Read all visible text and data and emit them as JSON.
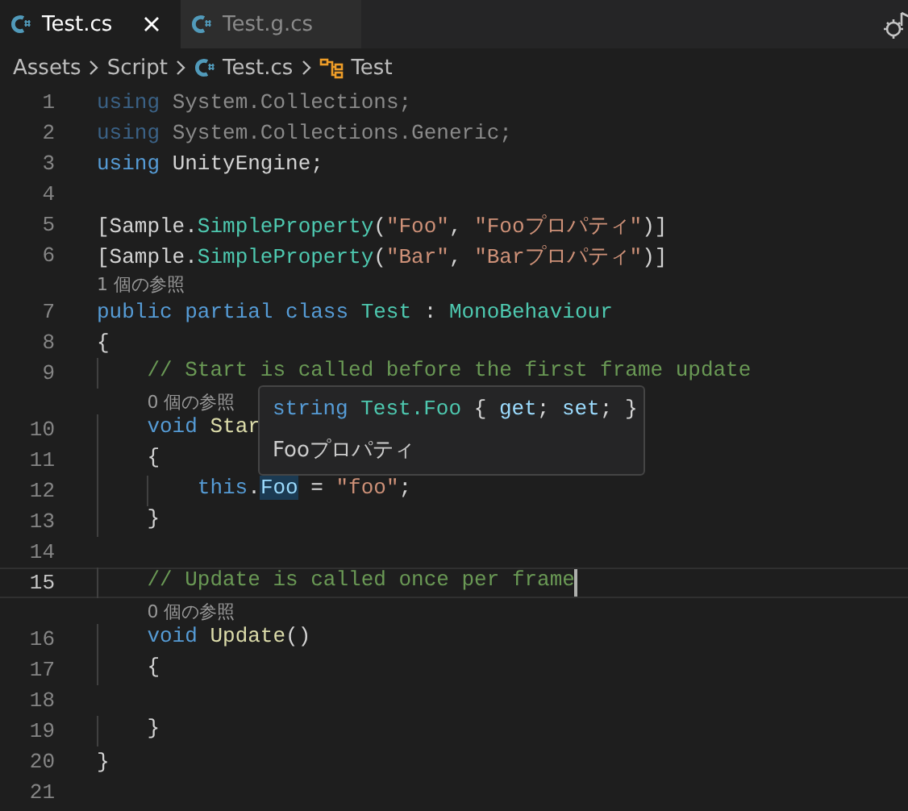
{
  "tabs": [
    {
      "label": "Test.cs",
      "selected": true,
      "closable": true
    },
    {
      "label": "Test.g.cs",
      "selected": false,
      "closable": false
    }
  ],
  "breadcrumb": [
    {
      "label": "Assets",
      "kind": "folder"
    },
    {
      "label": "Script",
      "kind": "folder"
    },
    {
      "label": "Test.cs",
      "kind": "file"
    },
    {
      "label": "Test",
      "kind": "class"
    }
  ],
  "editor": {
    "lines": [
      {
        "kind": "code",
        "number": "1",
        "current": false,
        "faded": true,
        "tokens": [
          {
            "text": "using",
            "kind": "keyword"
          },
          {
            "text": " System.Collections;",
            "kind": "plain"
          }
        ]
      },
      {
        "kind": "code",
        "number": "2",
        "current": false,
        "faded": true,
        "tokens": [
          {
            "text": "using",
            "kind": "keyword"
          },
          {
            "text": " System.Collections.Generic;",
            "kind": "plain"
          }
        ]
      },
      {
        "kind": "code",
        "number": "3",
        "current": false,
        "faded": false,
        "tokens": [
          {
            "text": "using",
            "kind": "keyword"
          },
          {
            "text": " UnityEngine;",
            "kind": "plain"
          }
        ]
      },
      {
        "kind": "code",
        "number": "4",
        "current": false
      },
      {
        "kind": "code",
        "number": "5",
        "current": false,
        "faded": false,
        "tokens": [
          {
            "text": "[Sample.",
            "kind": "plain"
          },
          {
            "text": "SimpleProperty",
            "kind": "type"
          },
          {
            "text": "(",
            "kind": "plain"
          },
          {
            "text": "\"Foo\"",
            "kind": "string"
          },
          {
            "text": ", ",
            "kind": "plain"
          },
          {
            "text": "\"Fooプロパティ\"",
            "kind": "string"
          },
          {
            "text": ")]",
            "kind": "plain"
          }
        ]
      },
      {
        "kind": "code",
        "number": "6",
        "current": false,
        "faded": false,
        "tokens": [
          {
            "text": "[Sample.",
            "kind": "plain"
          },
          {
            "text": "SimpleProperty",
            "kind": "type"
          },
          {
            "text": "(",
            "kind": "plain"
          },
          {
            "text": "\"Bar\"",
            "kind": "string"
          },
          {
            "text": ", ",
            "kind": "plain"
          },
          {
            "text": "\"Barプロパティ\"",
            "kind": "string"
          },
          {
            "text": ")]",
            "kind": "plain"
          }
        ]
      },
      {
        "kind": "codelens",
        "text": "1 個の参照"
      },
      {
        "kind": "code",
        "number": "7",
        "current": false,
        "faded": false,
        "tokens": [
          {
            "text": "public partial class",
            "kind": "keyword"
          },
          {
            "text": " Test",
            "kind": "type"
          },
          {
            "text": " : ",
            "kind": "plain"
          },
          {
            "text": "MonoBehaviour",
            "kind": "type"
          }
        ]
      },
      {
        "kind": "code",
        "number": "8",
        "current": false,
        "faded": false,
        "tokens": [
          {
            "text": "{",
            "kind": "plain"
          }
        ]
      },
      {
        "kind": "code",
        "number": "9",
        "current": false,
        "faded": false,
        "tokens": [
          {
            "text": "    // Start is called before the first frame update",
            "kind": "comment"
          }
        ]
      },
      {
        "kind": "codelens",
        "text": "    0 個の参照"
      },
      {
        "kind": "code",
        "number": "10",
        "current": false,
        "faded": false,
        "tokens": [
          {
            "text": "    void",
            "kind": "keyword"
          },
          {
            "text": " Star",
            "kind": "function"
          }
        ]
      },
      {
        "kind": "code",
        "number": "11",
        "current": false,
        "faded": false,
        "tokens": [
          {
            "text": "    {",
            "kind": "plain"
          }
        ]
      },
      {
        "kind": "code",
        "number": "12",
        "current": false,
        "faded": false,
        "tokens": [
          {
            "text": "        this",
            "kind": "keyword"
          },
          {
            "text": ".",
            "kind": "plain"
          },
          {
            "text": "Foo",
            "kind": "property",
            "highlighted": true
          },
          {
            "text": " = ",
            "kind": "plain"
          },
          {
            "text": "\"foo\"",
            "kind": "string"
          },
          {
            "text": ";",
            "kind": "plain"
          }
        ]
      },
      {
        "kind": "code",
        "number": "13",
        "current": false,
        "faded": false,
        "tokens": [
          {
            "text": "    }",
            "kind": "plain"
          }
        ]
      },
      {
        "kind": "code",
        "number": "14",
        "current": false
      },
      {
        "kind": "code",
        "number": "15",
        "current": true,
        "faded": false,
        "tokens": [
          {
            "text": "    // Update is called once per frame",
            "kind": "comment"
          }
        ]
      },
      {
        "kind": "codelens",
        "text": "    0 個の参照"
      },
      {
        "kind": "code",
        "number": "16",
        "current": false,
        "faded": false,
        "tokens": [
          {
            "text": "    void",
            "kind": "keyword"
          },
          {
            "text": " Update",
            "kind": "function"
          },
          {
            "text": "()",
            "kind": "plain"
          }
        ]
      },
      {
        "kind": "code",
        "number": "17",
        "current": false,
        "faded": false,
        "tokens": [
          {
            "text": "    {",
            "kind": "plain"
          }
        ]
      },
      {
        "kind": "code",
        "number": "18",
        "current": false
      },
      {
        "kind": "code",
        "number": "19",
        "current": false,
        "faded": false,
        "tokens": [
          {
            "text": "    }",
            "kind": "plain"
          }
        ]
      },
      {
        "kind": "code",
        "number": "20",
        "current": false,
        "faded": false,
        "tokens": [
          {
            "text": "}",
            "kind": "plain"
          }
        ]
      },
      {
        "kind": "code",
        "number": "21",
        "current": false
      }
    ]
  },
  "hover": {
    "signature": [
      {
        "text": "string",
        "kind": "keyword"
      },
      {
        "text": " Test.Foo",
        "kind": "type"
      },
      {
        "text": " { ",
        "kind": "plain"
      },
      {
        "text": "get",
        "kind": "property"
      },
      {
        "text": "; ",
        "kind": "plain"
      },
      {
        "text": "set",
        "kind": "property"
      },
      {
        "text": "; }",
        "kind": "plain"
      }
    ],
    "description": "Fooプロパティ"
  }
}
